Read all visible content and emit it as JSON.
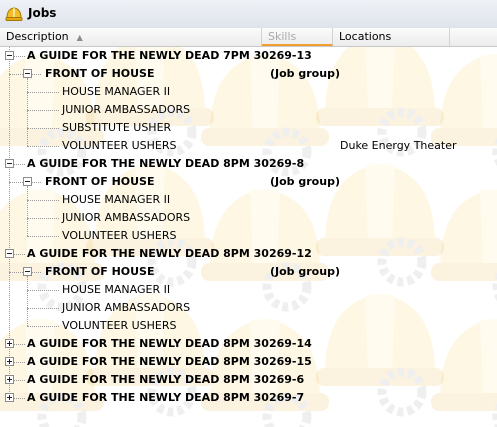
{
  "window": {
    "title": "Jobs"
  },
  "columns": {
    "description": "Description",
    "skills": "Skills",
    "locations": "Locations"
  },
  "tree": [
    {
      "label": "A GUIDE FOR THE NEWLY DEAD 7PM 30269-13",
      "expanded": true,
      "groups": [
        {
          "label": "FRONT OF HOUSE",
          "tag": "(Job group)",
          "jobs": [
            {
              "label": "HOUSE MANAGER II",
              "location": ""
            },
            {
              "label": "JUNIOR AMBASSADORS",
              "location": ""
            },
            {
              "label": "SUBSTITUTE USHER",
              "location": ""
            },
            {
              "label": "VOLUNTEER USHERS",
              "location": "Duke Energy Theater"
            }
          ]
        }
      ]
    },
    {
      "label": "A GUIDE FOR THE NEWLY DEAD 8PM  30269-8",
      "expanded": true,
      "groups": [
        {
          "label": "FRONT OF HOUSE",
          "tag": "(Job group)",
          "jobs": [
            {
              "label": "HOUSE MANAGER II",
              "location": ""
            },
            {
              "label": "JUNIOR AMBASSADORS",
              "location": ""
            },
            {
              "label": "VOLUNTEER USHERS",
              "location": ""
            }
          ]
        }
      ]
    },
    {
      "label": "A GUIDE FOR THE NEWLY DEAD 8PM 30269-12",
      "expanded": true,
      "groups": [
        {
          "label": "FRONT OF HOUSE",
          "tag": "(Job group)",
          "jobs": [
            {
              "label": "HOUSE MANAGER II",
              "location": ""
            },
            {
              "label": "JUNIOR AMBASSADORS",
              "location": ""
            },
            {
              "label": "VOLUNTEER USHERS",
              "location": ""
            }
          ]
        }
      ]
    },
    {
      "label": "A GUIDE FOR THE NEWLY DEAD 8PM 30269-14",
      "expanded": false,
      "groups": []
    },
    {
      "label": "A GUIDE FOR THE NEWLY DEAD 8PM 30269-15",
      "expanded": false,
      "groups": []
    },
    {
      "label": "A GUIDE FOR THE NEWLY DEAD 8PM 30269-6",
      "expanded": false,
      "groups": []
    },
    {
      "label": "A GUIDE FOR THE NEWLY DEAD 8PM 30269-7",
      "expanded": false,
      "groups": []
    }
  ],
  "colors": {
    "helmet": "#f7c63a",
    "skills_underline": "#f0a030"
  },
  "icons": {
    "title": "hard-hat-icon",
    "sort": "sort-ascending-icon",
    "watermark": "hard-hat-watermark"
  }
}
